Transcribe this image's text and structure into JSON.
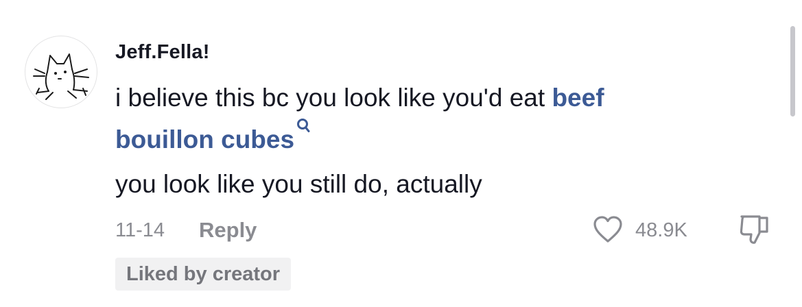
{
  "comment": {
    "username": "Jeff.Fella!",
    "avatar_icon": "cat-drawing-avatar",
    "text_line1_prefix": "i believe this bc you look like you'd eat ",
    "text_line1_link": "beef",
    "text_line2_link": "bouillon cubes",
    "search_icon": "search-icon",
    "text_line3": "you look like you still do, actually",
    "date": "11-14",
    "reply_label": "Reply",
    "like_icon": "heart-icon",
    "like_count": "48.9K",
    "dislike_icon": "thumbs-down-icon",
    "badge": "Liked by creator"
  },
  "colors": {
    "text": "#161823",
    "link": "#3c5a95",
    "meta": "#8a8b91",
    "badge_bg": "#f1f1f2"
  }
}
